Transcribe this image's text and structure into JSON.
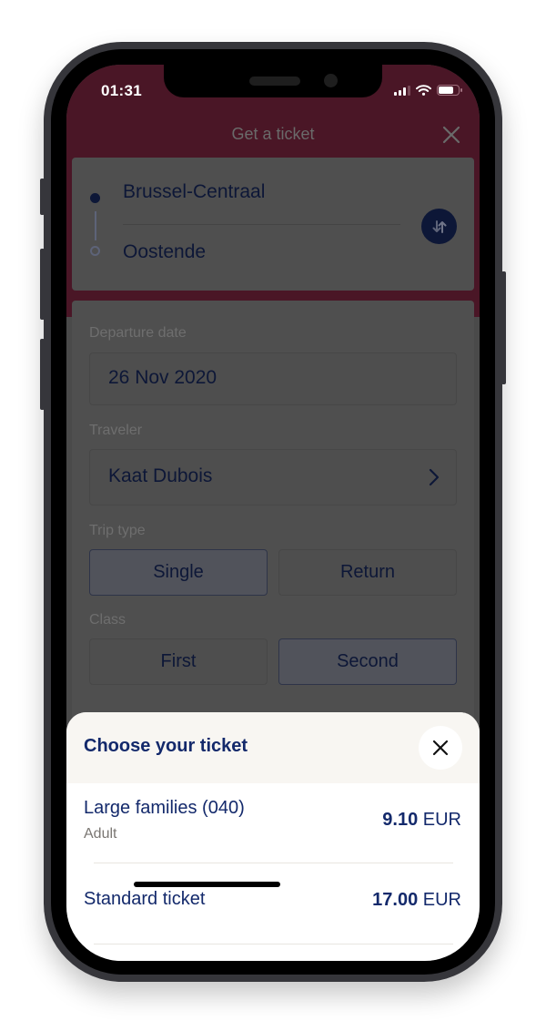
{
  "status_bar": {
    "time": "01:31",
    "icons": [
      "cellular-signal-icon",
      "wifi-icon",
      "battery-icon"
    ]
  },
  "nav": {
    "title": "Get a ticket",
    "close_icon": "close-icon"
  },
  "route": {
    "from": "Brussel-Centraal",
    "to": "Oostende",
    "swap_icon": "swap-arrows-icon"
  },
  "form": {
    "departure_date": {
      "label": "Departure date",
      "value": "26 Nov 2020"
    },
    "traveler": {
      "label": "Traveler",
      "value": "Kaat Dubois"
    },
    "trip_type": {
      "label": "Trip type",
      "options": [
        "Single",
        "Return"
      ],
      "selected": "Single"
    },
    "class": {
      "label": "Class",
      "options": [
        "First",
        "Second"
      ],
      "selected": "Second"
    }
  },
  "sheet": {
    "title": "Choose your ticket",
    "tickets": [
      {
        "name": "Large families (040)",
        "subtitle": "Adult",
        "price": "9.10",
        "currency": "EUR"
      },
      {
        "name": "Standard ticket",
        "subtitle": "",
        "price": "17.00",
        "currency": "EUR"
      }
    ]
  },
  "colors": {
    "brand_maroon": "#4a1626",
    "navy": "#13296b",
    "dark_navy": "#0d1737",
    "overlay_gray": "#4a4a4a",
    "sheet_header": "#f8f6f2"
  }
}
